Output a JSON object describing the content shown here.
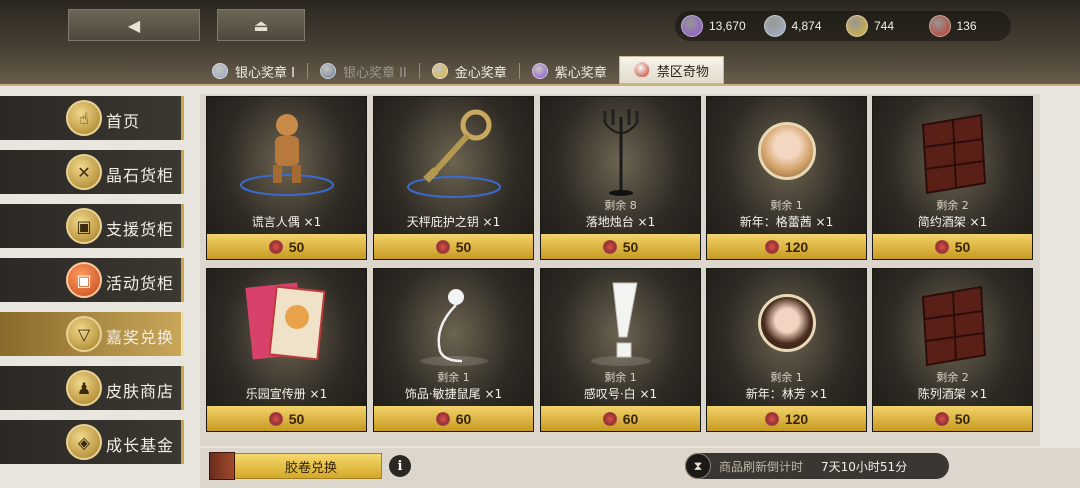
{
  "nav": {
    "back_icon": "back-arrow-icon",
    "home_icon": "home-icon"
  },
  "currencies": [
    {
      "icon": "purple-gem-icon",
      "color": "#8b56d6",
      "value": "13,670"
    },
    {
      "icon": "silver-gem-icon",
      "color": "#9fb3c8",
      "value": "4,874"
    },
    {
      "icon": "gold-gem-icon",
      "color": "#d9b53b",
      "value": "744"
    },
    {
      "icon": "red-token-icon",
      "color": "#c0392b",
      "value": "136"
    }
  ],
  "tabs": [
    {
      "label": "银心奖章 I",
      "medal_color": "#8fa6c2",
      "state": "normal"
    },
    {
      "label": "银心奖章 II",
      "medal_color": "#6f8299",
      "state": "dim"
    },
    {
      "label": "金心奖章",
      "medal_color": "#d9b53b",
      "state": "normal"
    },
    {
      "label": "紫心奖章",
      "medal_color": "#8b56d6",
      "state": "normal"
    },
    {
      "label": "禁区奇物",
      "medal_color": "#c0392b",
      "state": "active"
    }
  ],
  "sidebar": [
    {
      "label": "首页",
      "icon": "hand-icon",
      "glyph": "☝"
    },
    {
      "label": "晶石货柜",
      "icon": "crystal-icon",
      "glyph": "✕"
    },
    {
      "label": "支援货柜",
      "icon": "supply-box-icon",
      "glyph": "▣"
    },
    {
      "label": "活动货柜",
      "icon": "event-box-icon",
      "glyph": "▣"
    },
    {
      "label": "嘉奖兑换",
      "icon": "exchange-icon",
      "glyph": "▽"
    },
    {
      "label": "皮肤商店",
      "icon": "outfit-icon",
      "glyph": "♟"
    },
    {
      "label": "成长基金",
      "icon": "growth-fund-icon",
      "glyph": "◈"
    }
  ],
  "items": [
    {
      "name": "谎言人偶 ×1",
      "remain": "",
      "price": "50",
      "icon": "puppet-icon"
    },
    {
      "name": "天枰庇护之钥 ×1",
      "remain": "",
      "price": "50",
      "icon": "key-icon"
    },
    {
      "name": "落地烛台 ×1",
      "remain": "剩余 8",
      "price": "50",
      "icon": "candelabra-icon"
    },
    {
      "name": "新年：格蕾茜 ×1",
      "remain": "剩余 1",
      "price": "120",
      "icon": "character-avatar-icon"
    },
    {
      "name": "简约酒架 ×1",
      "remain": "剩余 2",
      "price": "50",
      "icon": "wine-rack-icon"
    },
    {
      "name": "乐园宣传册 ×1",
      "remain": "",
      "price": "50",
      "icon": "brochure-icon"
    },
    {
      "name": "饰品·敏捷鼠尾 ×1",
      "remain": "剩余 1",
      "price": "60",
      "icon": "mouse-tail-icon"
    },
    {
      "name": "感叹号·白 ×1",
      "remain": "剩余 1",
      "price": "60",
      "icon": "exclamation-icon"
    },
    {
      "name": "新年：林芳 ×1",
      "remain": "剩余 1",
      "price": "120",
      "icon": "character-avatar-icon"
    },
    {
      "name": "陈列酒架 ×1",
      "remain": "剩余 2",
      "price": "50",
      "icon": "wine-rack-icon"
    }
  ],
  "bottom": {
    "coupon_label": "胶卷兑换",
    "info_glyph": "i",
    "refresh_label": "商品刷新倒计时",
    "refresh_time": "7天10小时51分"
  }
}
